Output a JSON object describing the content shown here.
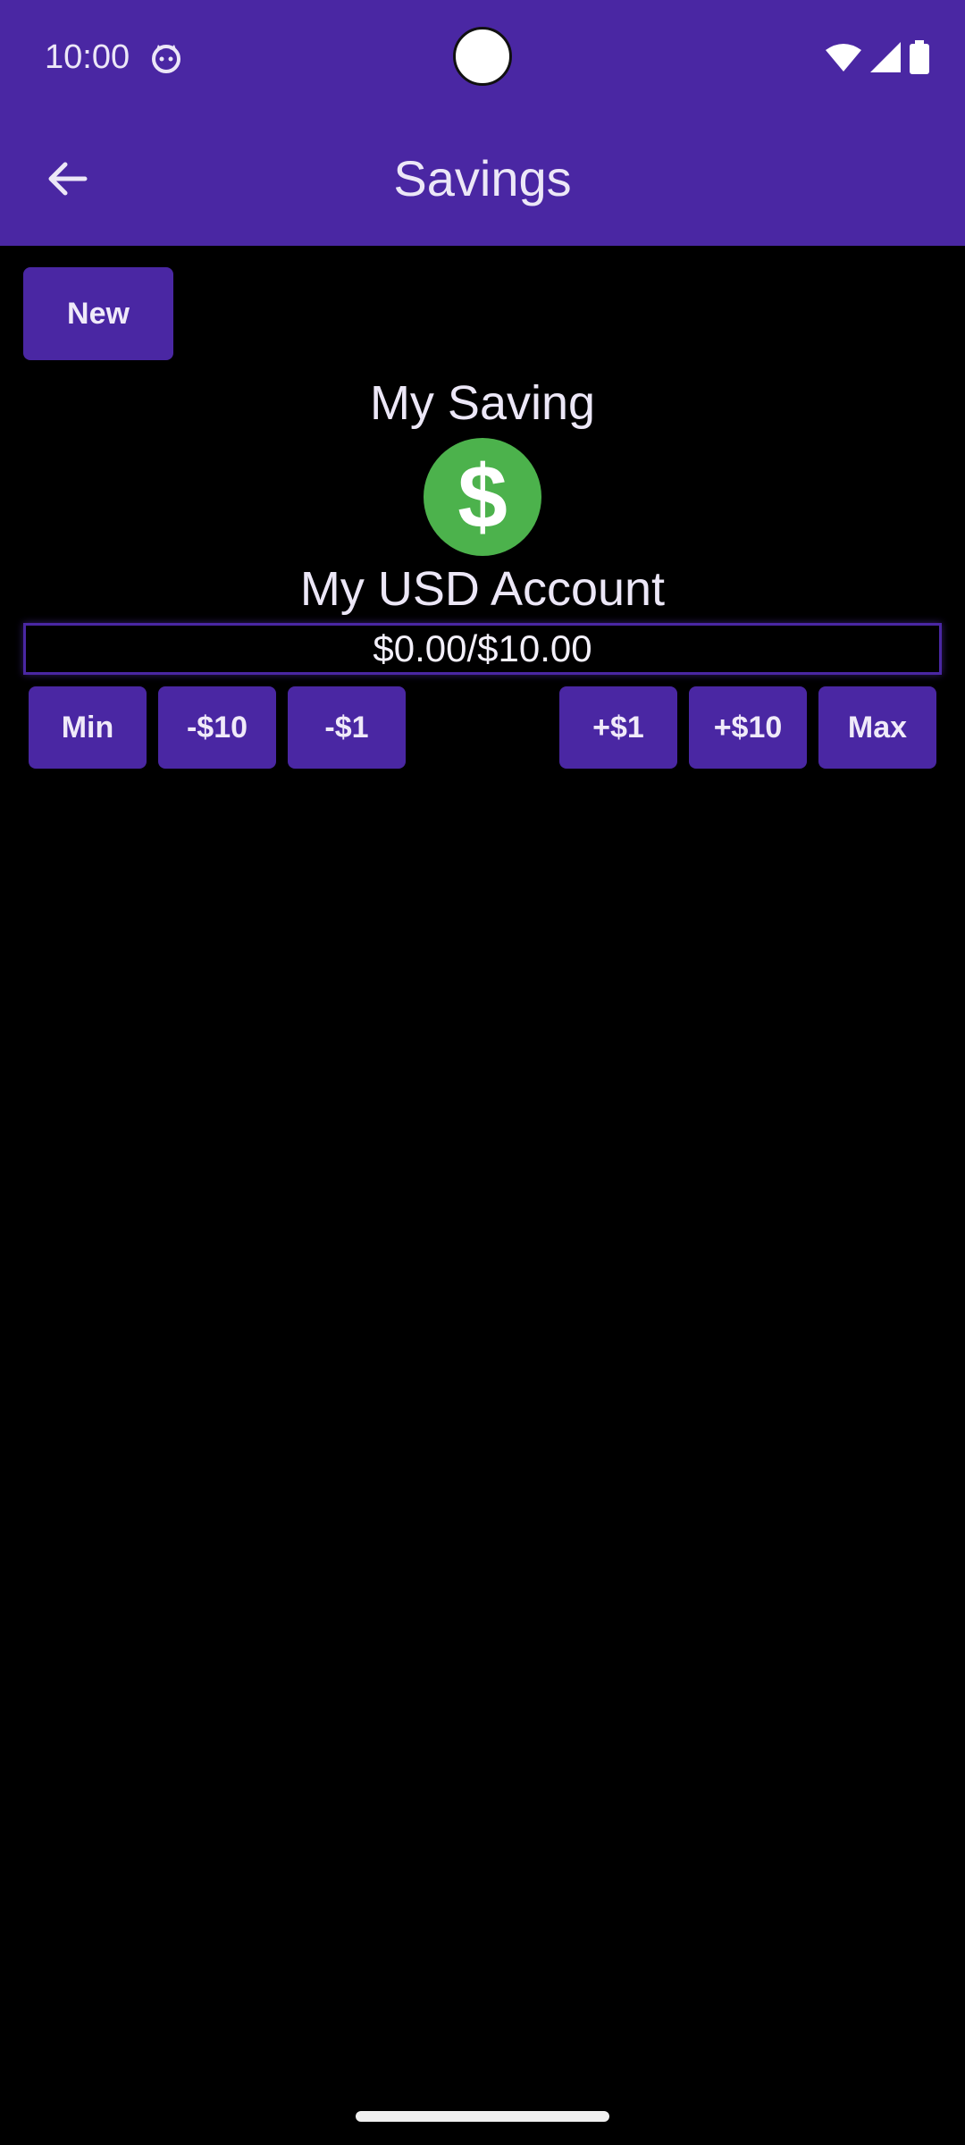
{
  "status_bar": {
    "time": "10:00",
    "icons": [
      "cat-notification-icon",
      "wifi-icon",
      "cellular-signal-icon",
      "battery-icon"
    ]
  },
  "app_bar": {
    "title": "Savings",
    "back_icon": "arrow-back-icon"
  },
  "toolbar": {
    "new_label": "New"
  },
  "saving": {
    "title": "My Saving",
    "icon": "dollar-coin-icon",
    "icon_glyph": "$",
    "account_name": "My USD Account",
    "progress_text": "$0.00/$10.00",
    "progress_fraction": 0
  },
  "adjust_buttons": {
    "min": "Min",
    "minus_10": "-$10",
    "minus_1": "-$1",
    "plus_1": "+$1",
    "plus_10": "+$10",
    "max": "Max"
  },
  "colors": {
    "primary": "#4a27a3",
    "coin": "#4cb24c",
    "background": "#000000",
    "text": "#ece7f7"
  }
}
